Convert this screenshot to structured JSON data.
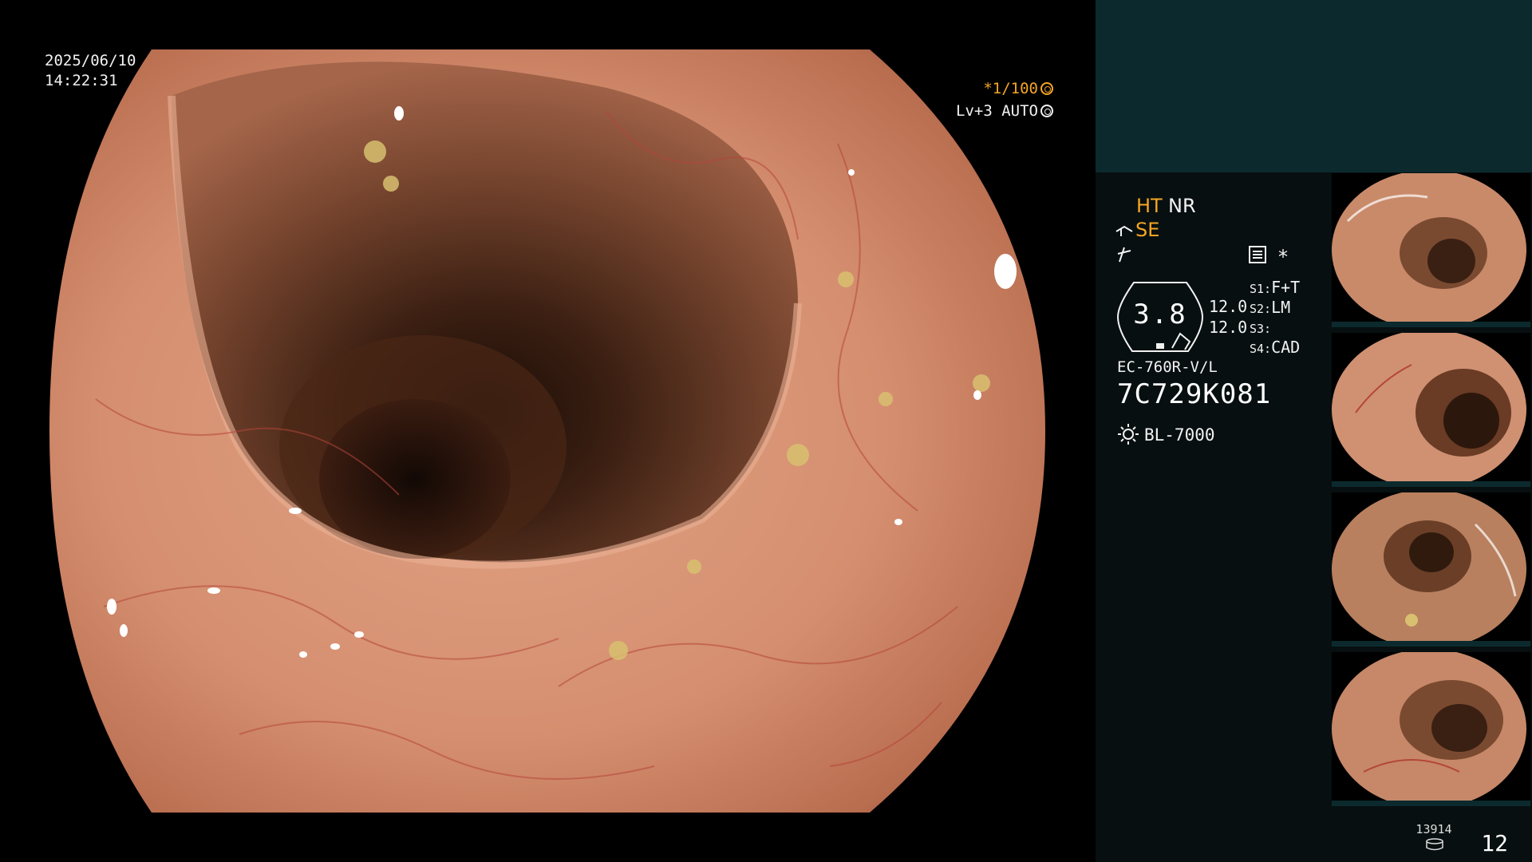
{
  "overlay": {
    "date": "2025/06/10",
    "time": "14:22:31",
    "shutter": "*1/100",
    "level": "Lv+3 AUTO"
  },
  "panel": {
    "ht": "HT",
    "nr": "NR",
    "se": "SE",
    "zoom": "3.8",
    "value_top": "12.0",
    "value_bottom": "12.0",
    "s1_key": "S1:",
    "s1_val": "F+T",
    "s2_key": "S2:",
    "s2_val": "LM",
    "s3_key": "S3:",
    "s3_val": "",
    "s4_key": "S4:",
    "s4_val": "CAD",
    "asterisk": "*",
    "model": "EC-760R-V/L",
    "serial": "7C729K081",
    "light_source": "BL-7000",
    "capture_count": "13914",
    "page": "12"
  },
  "colors": {
    "accent": "#f5a623",
    "panel_top": "#0c2a2d",
    "panel_bg": "#070f10"
  },
  "icons": [
    "scope-icon",
    "freeze-icon",
    "menu-icon",
    "sun-icon",
    "storage-icon",
    "iris-icon"
  ]
}
